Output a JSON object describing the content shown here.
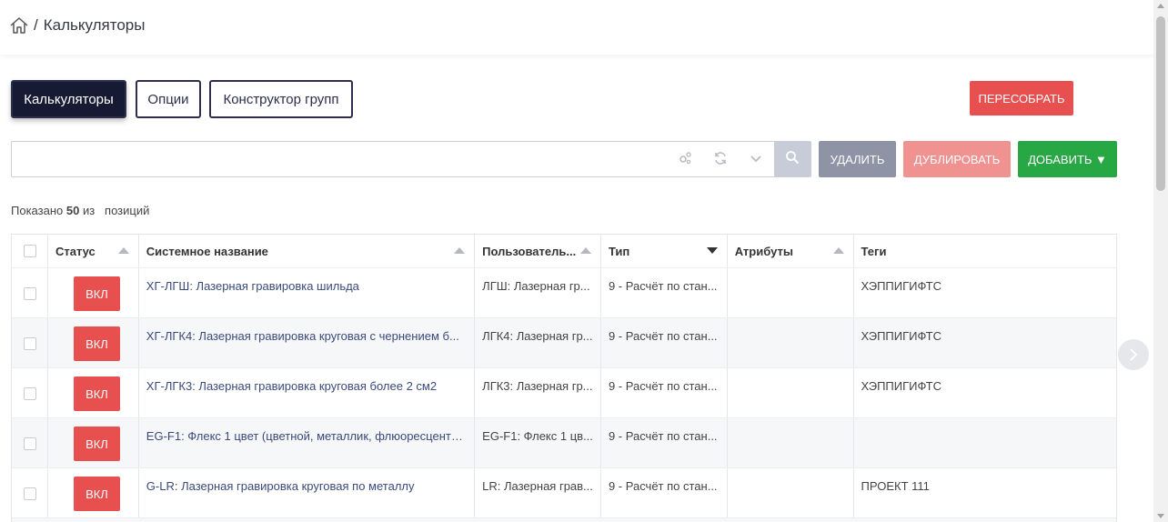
{
  "breadcrumb": {
    "separator": "/",
    "title": "Калькуляторы"
  },
  "tabs": [
    {
      "label": "Калькуляторы",
      "active": true
    },
    {
      "label": "Опции",
      "active": false
    },
    {
      "label": "Конструктор групп",
      "active": false
    }
  ],
  "rebuild_button": "ПЕРЕСОБРАТЬ",
  "search": {
    "value": "",
    "placeholder": ""
  },
  "actions": {
    "delete": "УДАЛИТЬ",
    "duplicate": "ДУБЛИРОВАТЬ",
    "add": "ДОБАВИТЬ ▼"
  },
  "summary": {
    "prefix": "Показано",
    "count": "50",
    "middle": "из",
    "suffix": "позиций"
  },
  "table": {
    "columns": [
      "Статус",
      "Системное название",
      "Пользователь...",
      "Тип",
      "Атрибуты",
      "Теги"
    ],
    "rows": [
      {
        "status": "ВКЛ",
        "system_name": "ХГ-ЛГШ: Лазерная гравировка шильда",
        "user_name": "ЛГШ: Лазерная гр...",
        "type": "9 - Расчёт по стан...",
        "attributes": "",
        "tags": "ХЭППИГИФТС"
      },
      {
        "status": "ВКЛ",
        "system_name": "ХГ-ЛГК4: Лазерная гравировка круговая с чернением б...",
        "user_name": "ЛГК4: Лазерная гр...",
        "type": "9 - Расчёт по стан...",
        "attributes": "",
        "tags": "ХЭППИГИФТС"
      },
      {
        "status": "ВКЛ",
        "system_name": "ХГ-ЛГК3: Лазерная гравировка круговая более 2 см2",
        "user_name": "ЛГК3: Лазерная гр...",
        "type": "9 - Расчёт по стан...",
        "attributes": "",
        "tags": "ХЭППИГИФТС"
      },
      {
        "status": "ВКЛ",
        "system_name": "EG-F1: Флекс 1 цвет (цветной, металлик, флюоресцентн...",
        "user_name": "EG-F1: Флекс 1 цв...",
        "type": "9 - Расчёт по стан...",
        "attributes": "",
        "tags": ""
      },
      {
        "status": "ВКЛ",
        "system_name": "G-LR: Лазерная гравировка круговая по металлу",
        "user_name": "LR: Лазерная грав...",
        "type": "9 - Расчёт по стан...",
        "attributes": "",
        "tags": "ПРОЕКТ 111"
      }
    ]
  },
  "colors": {
    "dark": "#161a33",
    "red": "#e8504f",
    "gray_button": "#8e93a5",
    "pink_button": "#f0928f",
    "green": "#28a745",
    "link": "#3a4a7c"
  },
  "icons": [
    "home-icon",
    "settings-gears-icon",
    "refresh-icon",
    "chevron-down-icon",
    "search-icon",
    "chevron-right-icon"
  ]
}
